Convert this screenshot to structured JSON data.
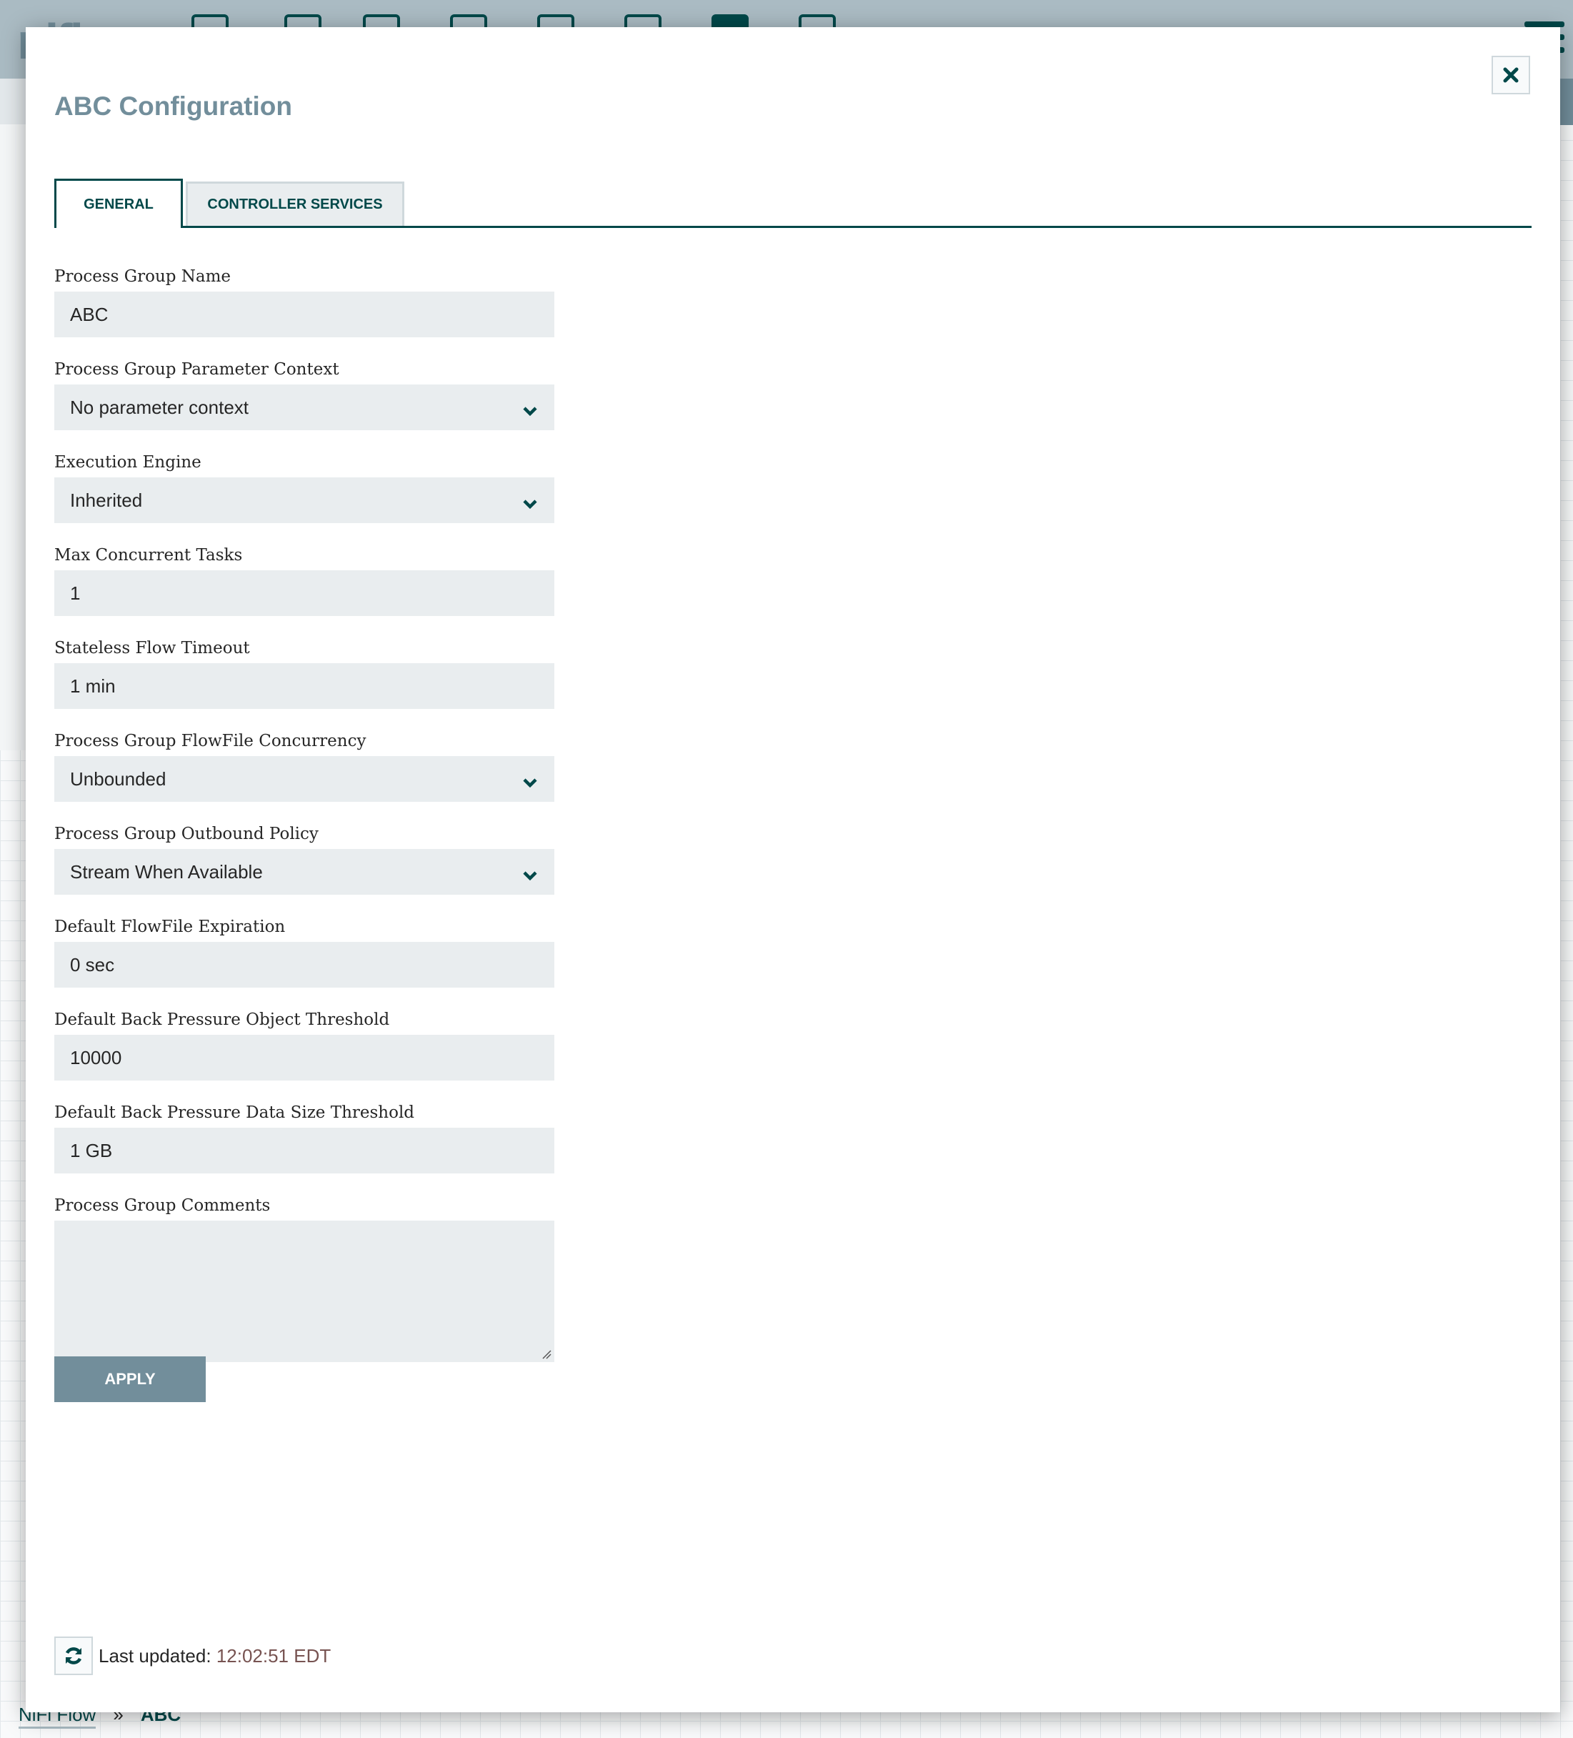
{
  "app": {
    "logo_text": "nifi"
  },
  "breadcrumb": {
    "root": "NiFi Flow",
    "separator": "»",
    "current": "ABC"
  },
  "dialog": {
    "title": "ABC Configuration",
    "close_icon": "close-icon",
    "tabs": [
      {
        "label": "GENERAL",
        "active": true
      },
      {
        "label": "CONTROLLER SERVICES",
        "active": false
      }
    ],
    "fields": {
      "name": {
        "label": "Process Group Name",
        "value": "ABC"
      },
      "parameter_context": {
        "label": "Process Group Parameter Context",
        "value": "No parameter context"
      },
      "execution_engine": {
        "label": "Execution Engine",
        "value": "Inherited"
      },
      "max_concurrent_tasks": {
        "label": "Max Concurrent Tasks",
        "value": "1"
      },
      "stateless_timeout": {
        "label": "Stateless Flow Timeout",
        "value": "1 min"
      },
      "flowfile_concurrency": {
        "label": "Process Group FlowFile Concurrency",
        "value": "Unbounded"
      },
      "outbound_policy": {
        "label": "Process Group Outbound Policy",
        "value": "Stream When Available"
      },
      "flowfile_expiration": {
        "label": "Default FlowFile Expiration",
        "value": "0 sec"
      },
      "bp_object_threshold": {
        "label": "Default Back Pressure Object Threshold",
        "value": "10000"
      },
      "bp_data_size_threshold": {
        "label": "Default Back Pressure Data Size Threshold",
        "value": "1 GB"
      },
      "comments": {
        "label": "Process Group Comments",
        "value": ""
      }
    },
    "apply_label": "APPLY",
    "footer": {
      "last_updated_label": "Last updated:",
      "last_updated_time": "12:02:51 EDT"
    }
  },
  "colors": {
    "primary": "#004849",
    "muted": "#728e9b",
    "input_bg": "#e9edef",
    "time": "#775351"
  }
}
